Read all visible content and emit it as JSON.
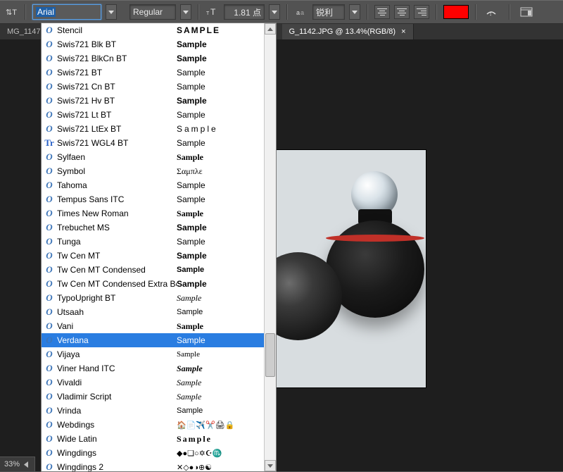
{
  "toolbar": {
    "font_name": "Arial",
    "font_style": "Regular",
    "font_size": "1.81 点",
    "sharpness": "锐利",
    "color": "#ff0000"
  },
  "tabs": {
    "left_partial": "MG_1147",
    "active": "G_1142.JPG @ 13.4%(RGB/8)"
  },
  "status": {
    "zoom": "33%"
  },
  "dropdown": {
    "selected_index": 22,
    "items": [
      {
        "name": "Stencil",
        "sample": "SAMPLE",
        "bold": true,
        "icontype": "O",
        "sample_family": "Arial Black, sans-serif",
        "sample_spacing": "2px"
      },
      {
        "name": "Swis721 Blk BT",
        "sample": "Sample",
        "bold": true,
        "icontype": "O",
        "sample_family": "Arial Black, sans-serif"
      },
      {
        "name": "Swis721 BlkCn BT",
        "sample": "Sample",
        "bold": true,
        "icontype": "O",
        "sample_family": "Arial Black, sans-serif",
        "sample_stretch": "condensed"
      },
      {
        "name": "Swis721 BT",
        "sample": "Sample",
        "bold": false,
        "icontype": "O",
        "sample_family": "Arial, sans-serif"
      },
      {
        "name": "Swis721 Cn BT",
        "sample": "Sample",
        "bold": false,
        "icontype": "O",
        "sample_family": "Arial Narrow, sans-serif"
      },
      {
        "name": "Swis721 Hv BT",
        "sample": "Sample",
        "bold": true,
        "icontype": "O",
        "sample_family": "Arial, sans-serif"
      },
      {
        "name": "Swis721 Lt BT",
        "sample": "Sample",
        "bold": false,
        "icontype": "O",
        "sample_family": "Arial, sans-serif",
        "sample_weight": "300"
      },
      {
        "name": "Swis721 LtEx BT",
        "sample": "Sample",
        "bold": false,
        "icontype": "O",
        "sample_family": "Arial, sans-serif",
        "sample_spacing": "3px",
        "sample_weight": "300"
      },
      {
        "name": "Swis721 WGL4 BT",
        "sample": "Sample",
        "bold": false,
        "icontype": "T",
        "sample_family": "Arial, sans-serif"
      },
      {
        "name": "Sylfaen",
        "sample": "Sample",
        "bold": true,
        "icontype": "O",
        "sample_family": "Georgia, serif"
      },
      {
        "name": "Symbol",
        "sample": "Σαμπλε",
        "bold": false,
        "icontype": "O",
        "sample_family": "Times New Roman, serif"
      },
      {
        "name": "Tahoma",
        "sample": "Sample",
        "bold": false,
        "icontype": "O",
        "sample_family": "Tahoma, sans-serif"
      },
      {
        "name": "Tempus Sans ITC",
        "sample": "Sample",
        "bold": false,
        "icontype": "O",
        "sample_family": "Papyrus, sans-serif"
      },
      {
        "name": "Times New Roman",
        "sample": "Sample",
        "bold": true,
        "icontype": "O",
        "sample_family": "Times New Roman, serif"
      },
      {
        "name": "Trebuchet MS",
        "sample": "Sample",
        "bold": true,
        "icontype": "O",
        "sample_family": "Trebuchet MS, sans-serif"
      },
      {
        "name": "Tunga",
        "sample": "Sample",
        "bold": false,
        "icontype": "O",
        "sample_family": "Tahoma, sans-serif"
      },
      {
        "name": "Tw Cen MT",
        "sample": "Sample",
        "bold": true,
        "icontype": "O",
        "sample_family": "Century Gothic, sans-serif"
      },
      {
        "name": "Tw Cen MT Condensed",
        "sample": "Sample",
        "bold": true,
        "icontype": "O",
        "sample_family": "Arial Narrow, sans-serif",
        "sample_size": "11px"
      },
      {
        "name": "Tw Cen MT Condensed Extra Bold",
        "sample": "Sample",
        "bold": true,
        "icontype": "O",
        "sample_family": "Arial Narrow, sans-serif"
      },
      {
        "name": "TypoUpright BT",
        "sample": "Sample",
        "bold": false,
        "icontype": "O",
        "sample_family": "Brush Script MT, cursive",
        "italic": true
      },
      {
        "name": "Utsaah",
        "sample": "Sample",
        "bold": false,
        "icontype": "O",
        "sample_family": "Tahoma, sans-serif",
        "sample_size": "11px"
      },
      {
        "name": "Vani",
        "sample": "Sample",
        "bold": true,
        "icontype": "O",
        "sample_family": "Georgia, serif"
      },
      {
        "name": "Verdana",
        "sample": "Sample",
        "bold": false,
        "icontype": "O",
        "sample_family": "Verdana, sans-serif"
      },
      {
        "name": "Vijaya",
        "sample": "Sample",
        "bold": false,
        "icontype": "O",
        "sample_family": "Georgia, serif",
        "sample_size": "11px"
      },
      {
        "name": "Viner Hand ITC",
        "sample": "Sample",
        "bold": true,
        "icontype": "O",
        "sample_family": "Brush Script MT, cursive",
        "italic": true
      },
      {
        "name": "Vivaldi",
        "sample": "Sample",
        "bold": false,
        "icontype": "O",
        "sample_family": "Brush Script MT, cursive",
        "italic": true
      },
      {
        "name": "Vladimir Script",
        "sample": "Sample",
        "bold": false,
        "icontype": "O",
        "sample_family": "Brush Script MT, cursive",
        "italic": true
      },
      {
        "name": "Vrinda",
        "sample": "Sample",
        "bold": false,
        "icontype": "O",
        "sample_family": "Tahoma, sans-serif",
        "sample_size": "11px"
      },
      {
        "name": "Webdings",
        "sample": "🏠📄✈‍✂🖨🔒",
        "bold": false,
        "icontype": "O",
        "sample_family": "Arial",
        "sample_size": "11px"
      },
      {
        "name": "Wide Latin",
        "sample": "Sample",
        "bold": true,
        "icontype": "O",
        "sample_family": "Arial Black, serif",
        "sample_spacing": "2px"
      },
      {
        "name": "Wingdings",
        "sample": "◆●❏○✡☪♏",
        "bold": false,
        "icontype": "O",
        "sample_family": "Arial",
        "sample_size": "11px"
      },
      {
        "name": "Wingdings 2",
        "sample": "✕◇●◑⊕☯",
        "bold": false,
        "icontype": "O",
        "sample_family": "Arial",
        "sample_size": "11px"
      }
    ]
  }
}
